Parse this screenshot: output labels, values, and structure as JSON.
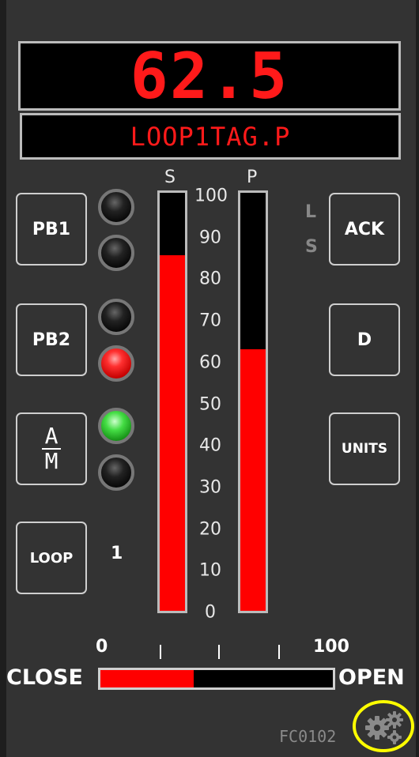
{
  "display": {
    "pv": "62.5",
    "tag": "LOOP1TAG.P"
  },
  "buttons": {
    "pb1": "PB1",
    "pb2": "PB2",
    "am_top": "A",
    "am_bottom": "M",
    "loop": "LOOP",
    "ack": "ACK",
    "d": "D",
    "units": "UNITS"
  },
  "loop_number": "1",
  "lamps": {
    "pb1_upper": "off",
    "pb1_lower": "off",
    "pb2_upper": "off",
    "pb2_lower": "red",
    "am_upper": "green",
    "am_lower": "off"
  },
  "indicators": {
    "l": "L",
    "s": "S"
  },
  "bargraph": {
    "setpoint_label": "S",
    "process_label": "P",
    "scale": [
      "100",
      "90",
      "80",
      "70",
      "60",
      "50",
      "40",
      "30",
      "20",
      "10",
      "0"
    ],
    "scale_min": 0,
    "scale_max": 100,
    "setpoint_value": 85,
    "process_value": 62.5
  },
  "valve": {
    "min_label": "0",
    "max_label": "100",
    "close_label": "CLOSE",
    "open_label": "OPEN",
    "output_percent": 40
  },
  "footer": {
    "tag": "FC0102"
  },
  "colors": {
    "bar": "#ff0000",
    "highlight_ring": "#ffff00",
    "lamp_red": "#ff3030",
    "lamp_green": "#44dd44"
  }
}
